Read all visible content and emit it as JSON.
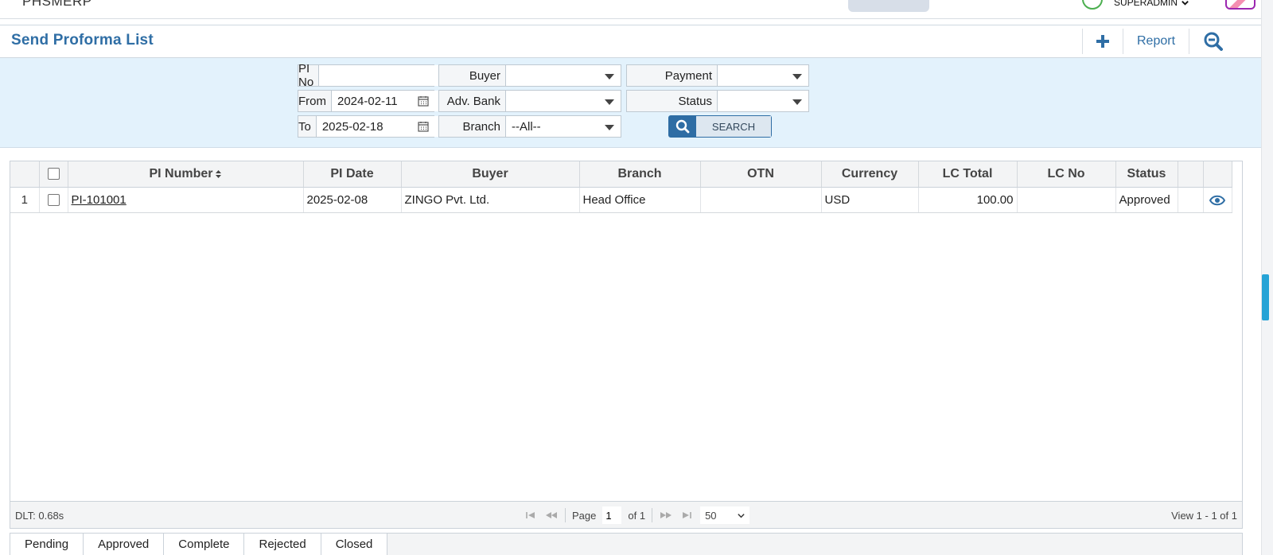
{
  "topbar": {
    "app_title": "PHSMERP",
    "user": "SUPERADMIN"
  },
  "page": {
    "title": "Send Proforma List",
    "report_label": "Report"
  },
  "filters": {
    "pi_no": {
      "label": "PI No",
      "value": ""
    },
    "from": {
      "label": "From",
      "value": "2024-02-11"
    },
    "to": {
      "label": "To",
      "value": "2025-02-18"
    },
    "buyer": {
      "label": "Buyer",
      "value": ""
    },
    "adv_bank": {
      "label": "Adv. Bank",
      "value": ""
    },
    "branch": {
      "label": "Branch",
      "value": "--All--"
    },
    "payment": {
      "label": "Payment",
      "value": ""
    },
    "status": {
      "label": "Status",
      "value": ""
    },
    "search_label": "SEARCH"
  },
  "grid": {
    "columns": [
      "PI Number",
      "PI Date",
      "Buyer",
      "Branch",
      "OTN",
      "Currency",
      "LC Total",
      "LC No",
      "Status"
    ],
    "rows": [
      {
        "row_num": "1",
        "pi_number": "PI-101001",
        "pi_date": "2025-02-08",
        "buyer": "ZINGO Pvt. Ltd.",
        "branch": "Head Office",
        "otn": "",
        "currency": "USD",
        "lc_total": "100.00",
        "lc_no": "",
        "status": "Approved"
      }
    ],
    "footer": {
      "dlt": "DLT: 0.68s",
      "page_label": "Page",
      "page_value": "1",
      "of_label": "of 1",
      "rows_per_page": "50",
      "view_text": "View 1 - 1 of 1"
    }
  },
  "tabs": [
    "Pending",
    "Approved",
    "Complete",
    "Rejected",
    "Closed"
  ],
  "colors": {
    "accent": "#2f6ea5",
    "filter_bg": "#e3f2fc",
    "scroll_thumb": "#26a3d6"
  }
}
